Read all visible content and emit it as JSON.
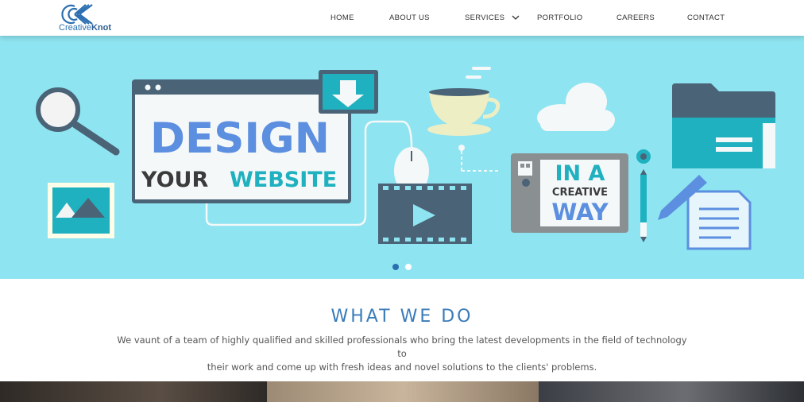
{
  "header": {
    "logo": {
      "name_part1": "Creative",
      "name_part2": "Knot",
      "icon": "ck-monogram-icon"
    },
    "nav": {
      "items": [
        {
          "label": "HOME"
        },
        {
          "label": "ABOUT US"
        },
        {
          "label": "SERVICES",
          "has_dropdown": true
        },
        {
          "label": "PORTFOLIO"
        },
        {
          "label": "CAREERS"
        },
        {
          "label": "CONTACT"
        }
      ]
    }
  },
  "hero": {
    "background": "#8ee4f0",
    "headline": "DESIGN",
    "subline_part1": "YOUR",
    "subline_part2": "WEBSITE",
    "tablet_line1": "IN A",
    "tablet_line2": "CREATIVE",
    "tablet_line3": "WAY",
    "slider": {
      "slide_count": 2,
      "active_slide": 1
    }
  },
  "what_we_do": {
    "title": "WHAT WE DO",
    "description_line1": "We vaunt of a team of highly qualified and skilled professionals who bring the latest developments in the field of technology to",
    "description_line2": "their work and come up with fresh ideas and novel solutions to the clients' problems."
  },
  "colors": {
    "accent": "#3a7bb8",
    "teal": "#1fb1bf",
    "slate": "#4a6377",
    "headline_blue": "#5c8fe0"
  }
}
